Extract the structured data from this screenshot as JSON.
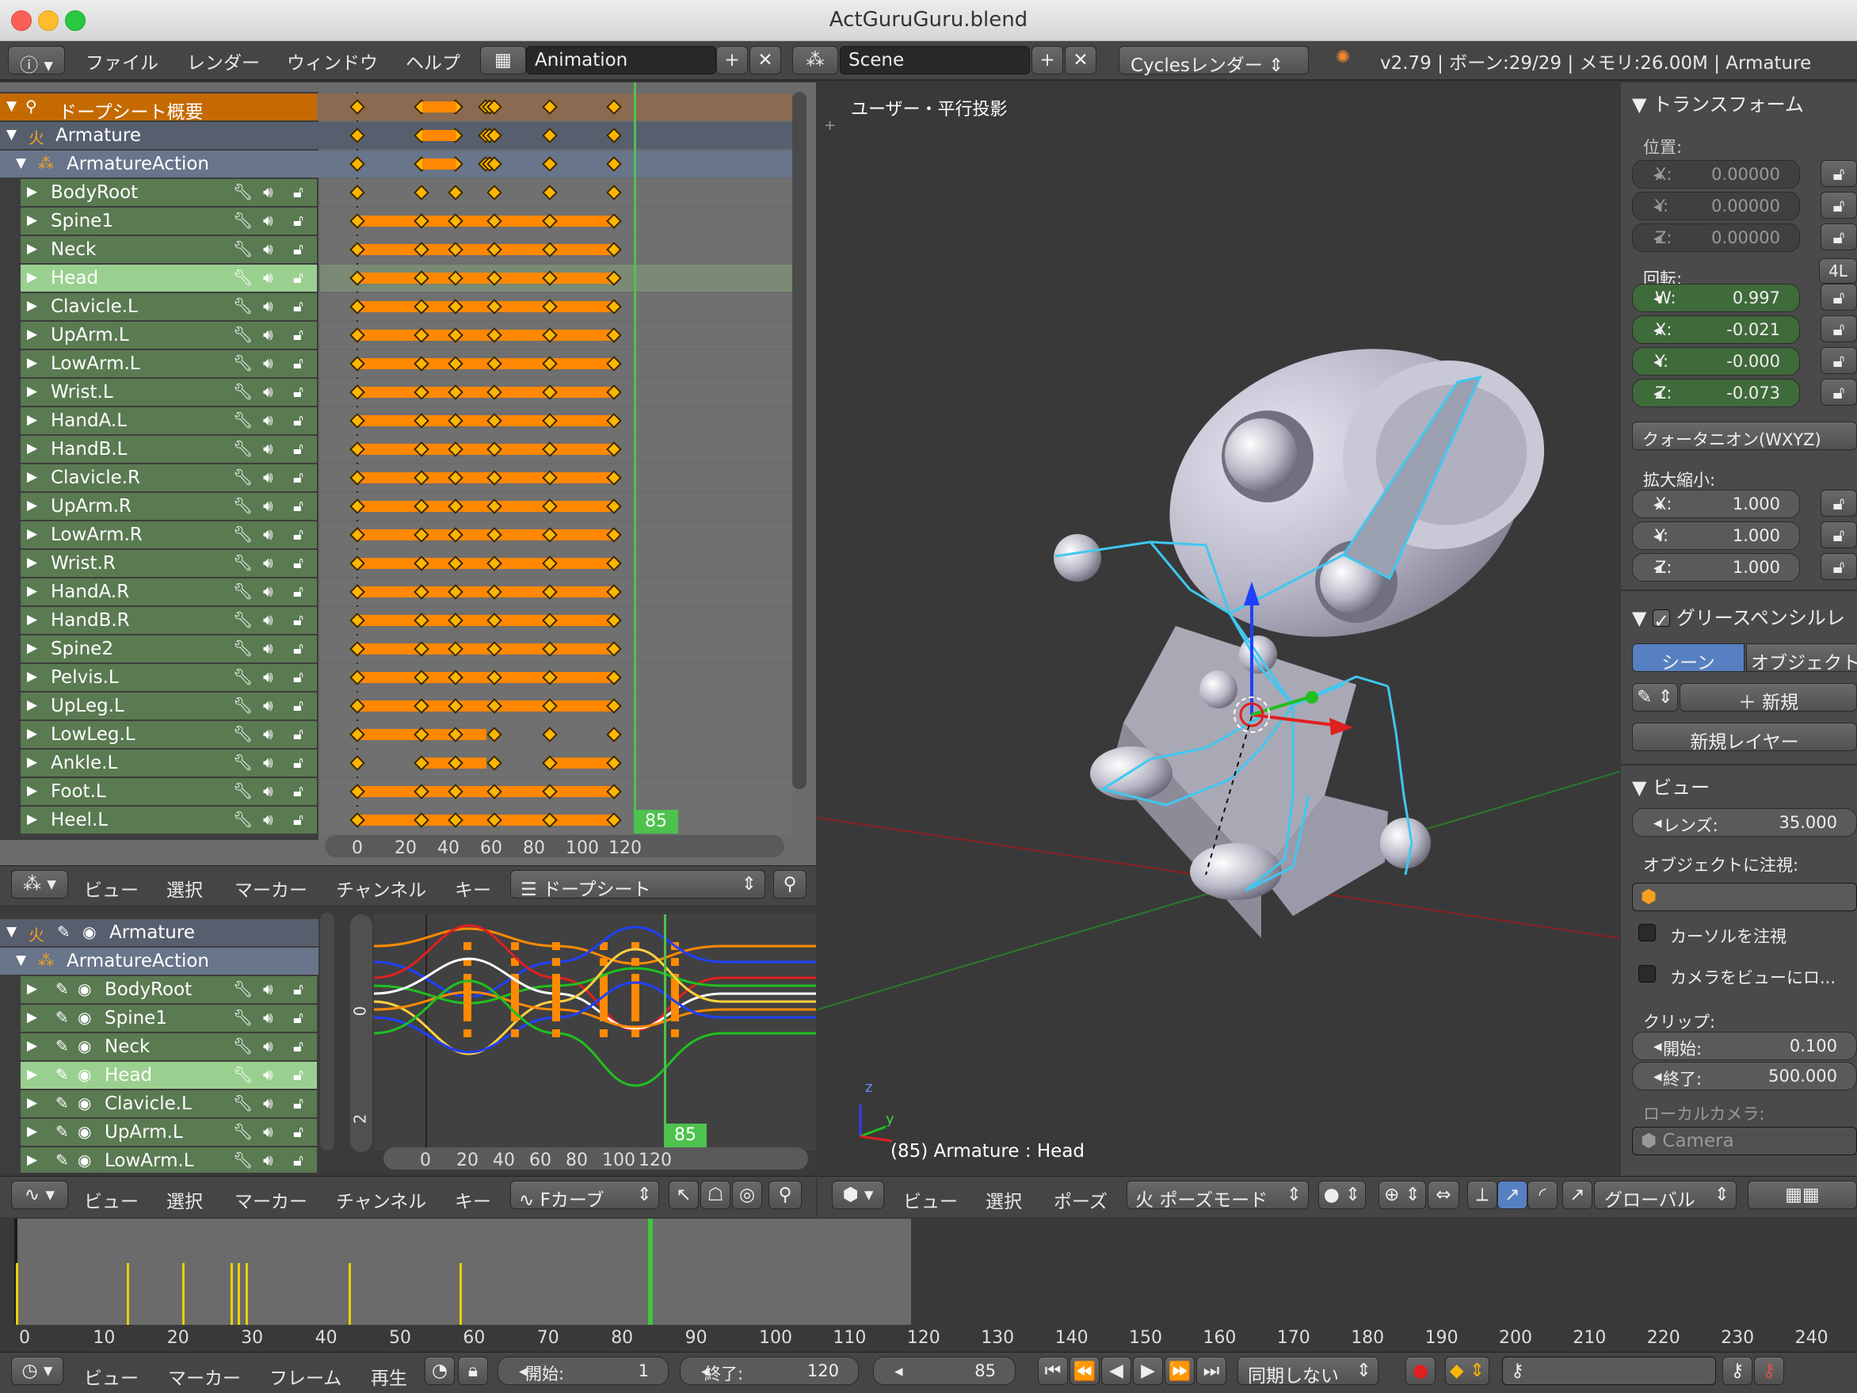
{
  "window": {
    "title": "ActGuruGuru.blend"
  },
  "info_header": {
    "menus": [
      "ファイル",
      "レンダー",
      "ウィンドウ",
      "ヘルプ"
    ],
    "screen_layout": "Animation",
    "scene": "Scene",
    "render_engine": "Cyclesレンダー",
    "stats": "v2.79 | ボーン:29/29 | メモリ:26.00M | Armature"
  },
  "dopesheet": {
    "summary_label": "ドープシート概要",
    "object": "Armature",
    "action": "ArmatureAction",
    "channels": [
      "BodyRoot",
      "Spine1",
      "Neck",
      "Head",
      "Clavicle.L",
      "UpArm.L",
      "LowArm.L",
      "Wrist.L",
      "HandA.L",
      "HandB.L",
      "Clavicle.R",
      "UpArm.R",
      "LowArm.R",
      "Wrist.R",
      "HandA.R",
      "HandB.R",
      "Spine2",
      "Pelvis.L",
      "UpLeg.L",
      "LowLeg.L",
      "Ankle.L",
      "Foot.L",
      "Heel.L"
    ],
    "selected_channel": "Head",
    "ruler": [
      "0",
      "20",
      "40",
      "60",
      "80",
      "100",
      "120"
    ],
    "current_frame": "85",
    "header_menus": [
      "ビュー",
      "選択",
      "マーカー",
      "チャンネル",
      "キー"
    ],
    "mode": "ドープシート"
  },
  "graph_editor": {
    "object": "Armature",
    "action": "ArmatureAction",
    "channels": [
      "BodyRoot",
      "Spine1",
      "Neck",
      "Head",
      "Clavicle.L",
      "UpArm.L",
      "LowArm.L"
    ],
    "ruler": [
      "0",
      "20",
      "40",
      "60",
      "80",
      "100",
      "120"
    ],
    "y_labels": [
      "0",
      "2"
    ],
    "current_frame": "85",
    "header_menus": [
      "ビュー",
      "選択",
      "マーカー",
      "チャンネル",
      "キー"
    ],
    "mode": "Fカーブ"
  },
  "viewport": {
    "view_label": "ユーザー・平行投影",
    "status": "(85) Armature : Head",
    "axis_labels": [
      "z",
      "y"
    ],
    "header_menus": [
      "ビュー",
      "選択",
      "ポーズ"
    ],
    "mode": "ポーズモード",
    "orientation": "グローバル"
  },
  "properties": {
    "transform": "トランスフォーム",
    "location_label": "位置:",
    "location": [
      {
        "axis": "X:",
        "value": "0.00000"
      },
      {
        "axis": "Y:",
        "value": "0.00000"
      },
      {
        "axis": "Z:",
        "value": "0.00000"
      }
    ],
    "rotation_label": "回転:",
    "rotation": [
      {
        "axis": "W:",
        "value": "0.997"
      },
      {
        "axis": "X:",
        "value": "-0.021"
      },
      {
        "axis": "Y:",
        "value": "-0.000"
      },
      {
        "axis": "Z:",
        "value": "-0.073"
      }
    ],
    "rot_4l": "4L",
    "rotation_mode": "クォータニオン(WXYZ)",
    "scale_label": "拡大縮小:",
    "scale": [
      {
        "axis": "X:",
        "value": "1.000"
      },
      {
        "axis": "Y:",
        "value": "1.000"
      },
      {
        "axis": "Z:",
        "value": "1.000"
      }
    ],
    "grease_pencil": "グリースペンシルレ",
    "gp_tabs": [
      "シーン",
      "オブジェクト"
    ],
    "gp_new": "新規",
    "gp_new_layer": "新規レイヤー",
    "view_section": "ビュー",
    "lens_label": "レンズ:",
    "lens_value": "35.000",
    "lock_to_object": "オブジェクトに注視:",
    "lock_cursor": "カーソルを注視",
    "lock_camera": "カメラをビューにロ...",
    "clip_label": "クリップ:",
    "clip_start_label": "開始:",
    "clip_start": "0.100",
    "clip_end_label": "終了:",
    "clip_end": "500.000",
    "local_camera": "ローカルカメラ:",
    "camera": "Camera"
  },
  "timeline": {
    "ruler": [
      "0",
      "10",
      "20",
      "30",
      "40",
      "50",
      "60",
      "70",
      "80",
      "90",
      "100",
      "110",
      "120",
      "130",
      "140",
      "150",
      "160",
      "170",
      "180",
      "190",
      "200",
      "210",
      "220",
      "230",
      "240"
    ],
    "header_menus": [
      "ビュー",
      "マーカー",
      "フレーム",
      "再生"
    ],
    "start_label": "開始:",
    "start": "1",
    "end_label": "終了:",
    "end": "120",
    "current": "85",
    "sync": "同期しない"
  },
  "colors": {
    "accent_orange": "#ff8a00",
    "current_frame": "#4ec24e",
    "selected_channel": "#9ad08f",
    "channel_green": "#5a7a52",
    "summary": "#c46a00"
  }
}
